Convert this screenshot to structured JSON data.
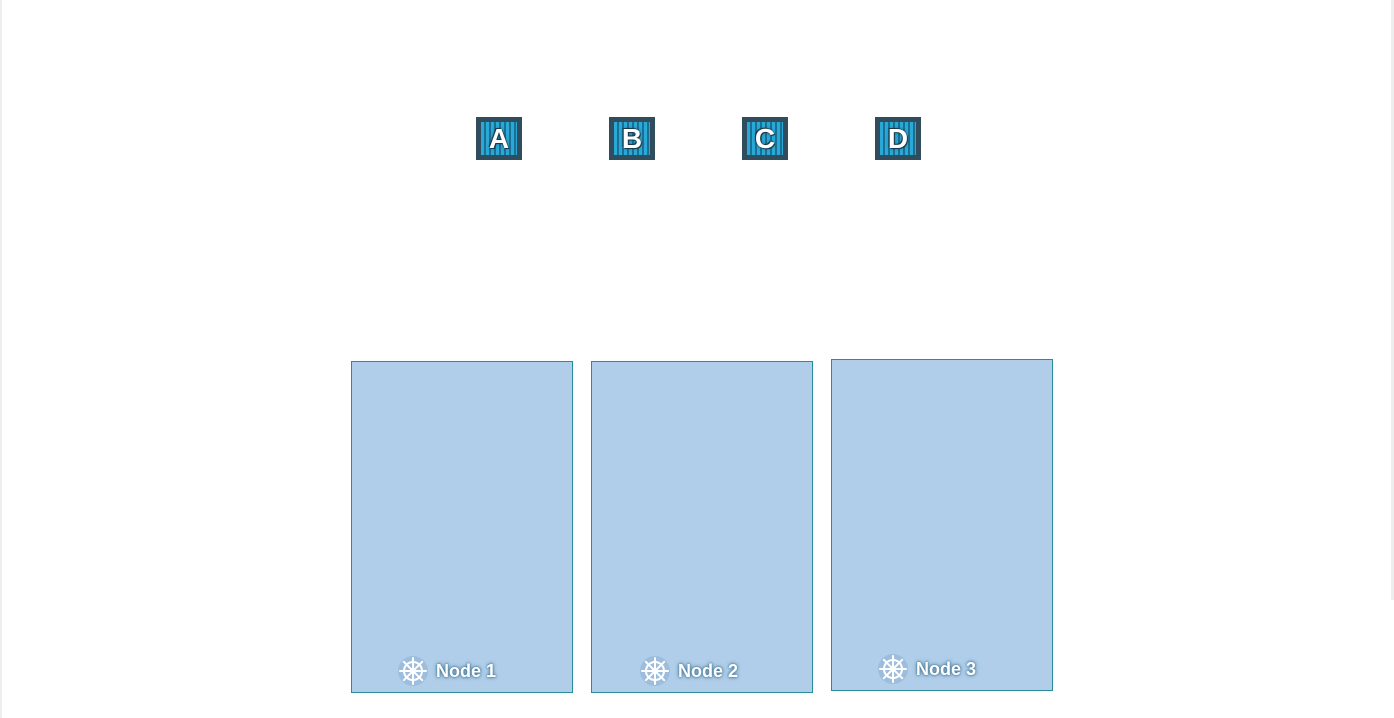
{
  "pods": [
    {
      "letter": "A"
    },
    {
      "letter": "B"
    },
    {
      "letter": "C"
    },
    {
      "letter": "D"
    }
  ],
  "nodes": [
    {
      "label": "Node 1"
    },
    {
      "label": "Node 2"
    },
    {
      "label": "Node 3"
    }
  ],
  "colors": {
    "pod_frame": "#2f4d5c",
    "pod_stripe": "#2aa8d8",
    "node_fill": "#b0cee9",
    "node_border": "#2a8c9a"
  },
  "icons": {
    "node_icon": "kubernetes-helm-icon"
  }
}
